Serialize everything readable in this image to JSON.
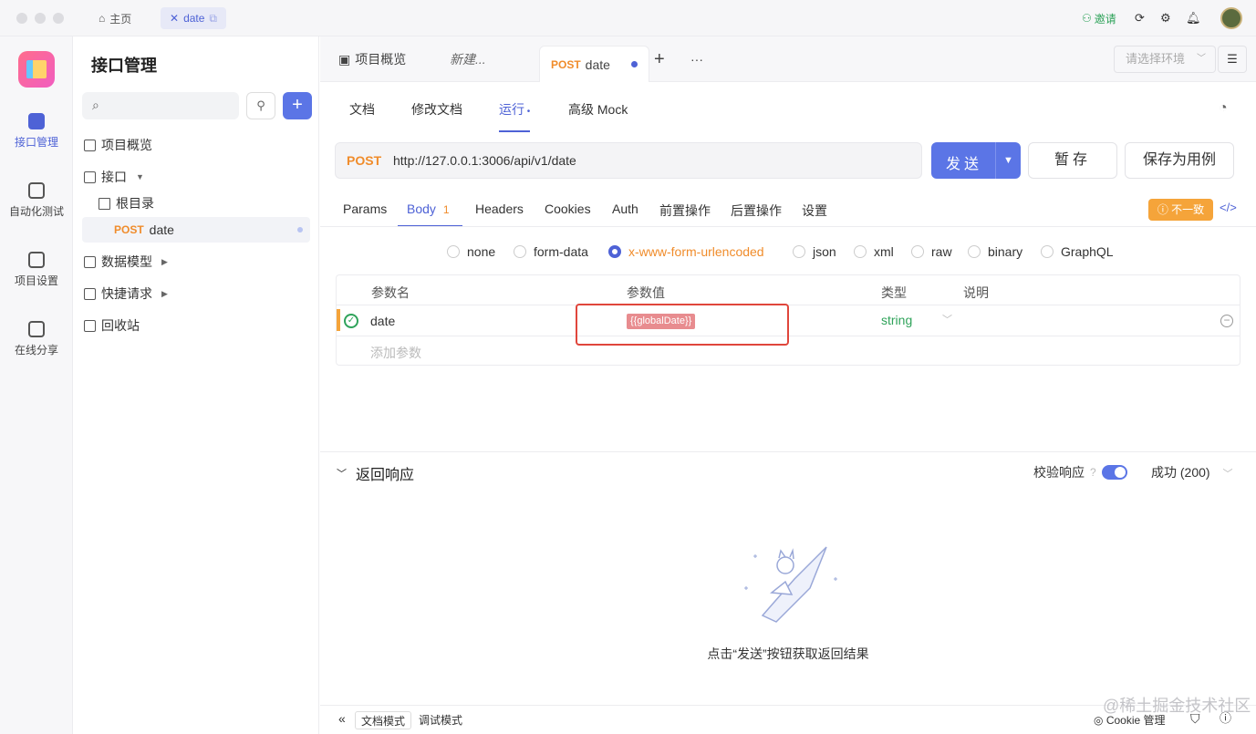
{
  "titlebar": {
    "home_label": "主页",
    "tab_label": "date",
    "invite_label": "邀请"
  },
  "rail": {
    "items": [
      {
        "label": "接口管理"
      },
      {
        "label": "自动化测试"
      },
      {
        "label": "项目设置"
      },
      {
        "label": "在线分享"
      }
    ]
  },
  "sidebar": {
    "title": "接口管理",
    "tree": [
      {
        "label": "项目概览"
      },
      {
        "label": "接口"
      },
      {
        "label": "根目录"
      },
      {
        "method": "POST",
        "label": "date"
      },
      {
        "label": "数据模型"
      },
      {
        "label": "快捷请求"
      },
      {
        "label": "回收站"
      }
    ]
  },
  "request_tabs": [
    {
      "label": "项目概览"
    },
    {
      "label": "新建..."
    },
    {
      "method": "POST",
      "label": "date"
    }
  ],
  "env_placeholder": "请选择环境",
  "sub_tabs": [
    "文档",
    "修改文档",
    "运行",
    "高级 Mock"
  ],
  "request": {
    "method": "POST",
    "url": "http://127.0.0.1:3006/api/v1/date",
    "send_label": "发送",
    "save_label": "暂存",
    "save_case_label": "保存为用例"
  },
  "param_tabs": [
    {
      "label": "Params"
    },
    {
      "label": "Body",
      "count": "1"
    },
    {
      "label": "Headers"
    },
    {
      "label": "Cookies"
    },
    {
      "label": "Auth"
    },
    {
      "label": "前置操作"
    },
    {
      "label": "后置操作"
    },
    {
      "label": "设置"
    }
  ],
  "inconsistent_label": "不一致",
  "body_types": [
    "none",
    "form-data",
    "x-www-form-urlencoded",
    "json",
    "xml",
    "raw",
    "binary",
    "GraphQL"
  ],
  "body_types_selected": "x-www-form-urlencoded",
  "table": {
    "headers": [
      "参数名",
      "参数值",
      "类型",
      "说明"
    ],
    "rows": [
      {
        "name": "date",
        "value": "{{globalDate}}",
        "type": "string",
        "desc": ""
      }
    ],
    "add_placeholder": "添加参数"
  },
  "response": {
    "title": "返回响应",
    "verify_label": "校验响应",
    "status_label": "成功 (200)",
    "empty_text": "点击“发送”按钮获取返回结果"
  },
  "footer": {
    "doc_mode": "文档模式",
    "debug_mode": "调试模式",
    "cookie_label": "Cookie 管理"
  },
  "watermark": "@稀土掘金技术社区",
  "colors": {
    "accent": "#5b75e6",
    "method": "#f08c2b",
    "highlight": "#e0463c"
  }
}
